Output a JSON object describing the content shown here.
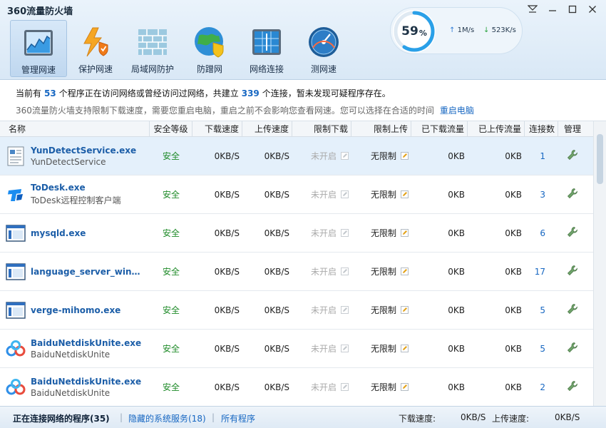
{
  "window": {
    "title": "360流量防火墙",
    "controls": [
      "menu-icon",
      "minimize-icon",
      "maximize-icon",
      "close-icon"
    ]
  },
  "nav": {
    "items": [
      {
        "label": "管理网速",
        "icon": "speed-chart-icon",
        "active": true
      },
      {
        "label": "保护网速",
        "icon": "lightning-shield-icon",
        "active": false
      },
      {
        "label": "局域网防护",
        "icon": "brick-wall-icon",
        "active": false
      },
      {
        "label": "防蹭网",
        "icon": "globe-shield-icon",
        "active": false
      },
      {
        "label": "网络连接",
        "icon": "network-monitor-icon",
        "active": false
      },
      {
        "label": "测网速",
        "icon": "speedometer-icon",
        "active": false
      }
    ]
  },
  "gauge": {
    "percent": "59",
    "unit": "%",
    "percent_value": 59,
    "upload": "1M/s",
    "download": "523K/s",
    "accent": "#2aa0e8"
  },
  "info": {
    "line1_pre": "当前有",
    "program_count": "53",
    "line1_mid": "个程序正在访问网络或曾经访问过网络，共建立",
    "connection_count": "339",
    "line1_post": "个连接，暂未发现可疑程序存在。",
    "line2": "360流量防火墙支持限制下载速度，需要您重启电脑，重启之前不会影响您查看网速。您可以选择在合适的时间",
    "restart_link": "重启电脑"
  },
  "table": {
    "headers": {
      "name": "名称",
      "level": "安全等级",
      "down": "下载速度",
      "up": "上传速度",
      "limit_down": "限制下载",
      "limit_up": "限制上传",
      "downloaded": "已下载流量",
      "uploaded": "已上传流量",
      "connections": "连接数",
      "manage": "管理"
    },
    "rows": [
      {
        "name": "YunDetectService.exe",
        "desc": "YunDetectService",
        "icon": "document-icon",
        "level": "安全",
        "down": "0KB/S",
        "up": "0KB/S",
        "limit_down": "未开启",
        "limit_up": "无限制",
        "downloaded": "0KB",
        "uploaded": "0KB",
        "connections": "1",
        "selected": true
      },
      {
        "name": "ToDesk.exe",
        "desc": "ToDesk远程控制客户端",
        "icon": "todesk-icon",
        "level": "安全",
        "down": "0KB/S",
        "up": "0KB/S",
        "limit_down": "未开启",
        "limit_up": "无限制",
        "downloaded": "0KB",
        "uploaded": "0KB",
        "connections": "3",
        "selected": false
      },
      {
        "name": "mysqld.exe",
        "desc": "",
        "icon": "window-app-icon",
        "level": "安全",
        "down": "0KB/S",
        "up": "0KB/S",
        "limit_down": "未开启",
        "limit_up": "无限制",
        "downloaded": "0KB",
        "uploaded": "0KB",
        "connections": "6",
        "selected": false
      },
      {
        "name": "language_server_wind...",
        "desc": "",
        "icon": "window-app-icon",
        "level": "安全",
        "down": "0KB/S",
        "up": "0KB/S",
        "limit_down": "未开启",
        "limit_up": "无限制",
        "downloaded": "0KB",
        "uploaded": "0KB",
        "connections": "17",
        "selected": false
      },
      {
        "name": "verge-mihomo.exe",
        "desc": "",
        "icon": "window-app-icon",
        "level": "安全",
        "down": "0KB/S",
        "up": "0KB/S",
        "limit_down": "未开启",
        "limit_up": "无限制",
        "downloaded": "0KB",
        "uploaded": "0KB",
        "connections": "5",
        "selected": false
      },
      {
        "name": "BaiduNetdiskUnite.exe",
        "desc": "BaiduNetdiskUnite",
        "icon": "baidu-netdisk-icon",
        "level": "安全",
        "down": "0KB/S",
        "up": "0KB/S",
        "limit_down": "未开启",
        "limit_up": "无限制",
        "downloaded": "0KB",
        "uploaded": "0KB",
        "connections": "5",
        "selected": false
      },
      {
        "name": "BaiduNetdiskUnite.exe",
        "desc": "BaiduNetdiskUnite",
        "icon": "baidu-netdisk-icon",
        "level": "安全",
        "down": "0KB/S",
        "up": "0KB/S",
        "limit_down": "未开启",
        "limit_up": "无限制",
        "downloaded": "0KB",
        "uploaded": "0KB",
        "connections": "2",
        "selected": false
      }
    ]
  },
  "statusbar": {
    "tab_connected": "正在连接网络的程序(35)",
    "tab_hidden": "隐藏的系统服务(18)",
    "tab_all": "所有程序",
    "sep": "|",
    "download_label": "下载速度:",
    "download_value": "0KB/S",
    "upload_label": "上传速度:",
    "upload_value": "0KB/S"
  },
  "colors": {
    "safe_green": "#1d8a27",
    "link_blue": "#1767c2",
    "header_bg": "#d9e8f6"
  }
}
